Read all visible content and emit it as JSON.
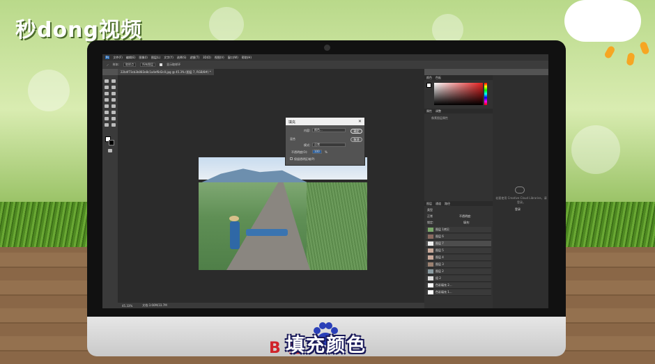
{
  "watermark": {
    "brand": "秒dong视频"
  },
  "caption": {
    "back_text": "B        验",
    "main_text": "填充颜色"
  },
  "photoshop": {
    "menu": [
      "文件(F)",
      "编辑(E)",
      "图像(I)",
      "图层(L)",
      "文字(Y)",
      "选择(S)",
      "滤镜(T)",
      "3D(D)",
      "视图(V)",
      "窗口(W)",
      "帮助(H)"
    ],
    "options": {
      "sample_label": "样本:",
      "sample_value": "取样点",
      "size_label": "所有图层",
      "checkbox": "显示取样环"
    },
    "tab_title": "22b4f73cb3b083e8c1a4ef6d2c0.jpg @ 45.3% (图层 7, RGB/8#) *",
    "status": {
      "zoom": "45.33%",
      "doc": "文档:3.66M/33.7M"
    },
    "dialog": {
      "title": "填充",
      "content_label": "内容:",
      "content_value": "颜色...",
      "blending": "混合",
      "mode_label": "模式:",
      "mode_value": "正常",
      "opacity_label": "不透明度(O):",
      "opacity_value": "100",
      "opacity_unit": "%",
      "preserve": "保留透明区域(P)",
      "ok": "确定",
      "cancel": "取消"
    },
    "color_panel": {
      "tabs": [
        "颜色",
        "色板"
      ]
    },
    "props_panel": {
      "tabs": [
        "属性",
        "调整"
      ],
      "subtitle": "像素图层属性"
    },
    "libraries": {
      "message": "若要使用 Creative Cloud Libraries，请登录。",
      "signin": "登录"
    },
    "layers_panel": {
      "tabs": [
        "图层",
        "通道",
        "路径"
      ],
      "kind": "类型",
      "blend_mode": "正常",
      "opacity_label": "不透明度:",
      "lock_label": "锁定:",
      "fill_label": "填充:",
      "layers": [
        {
          "name": "图层 1拷贝"
        },
        {
          "name": "图层 6"
        },
        {
          "name": "图层 7",
          "selected": true
        },
        {
          "name": "图层 5"
        },
        {
          "name": "图层 4"
        },
        {
          "name": "图层 3"
        },
        {
          "name": "图层 2"
        },
        {
          "name": "组 2"
        },
        {
          "name": "色彩填充 2..."
        },
        {
          "name": "色彩填充 1..."
        }
      ]
    }
  }
}
